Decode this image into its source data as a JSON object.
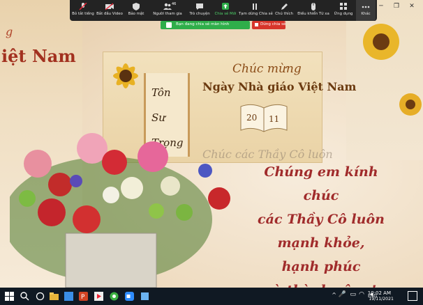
{
  "toolbar": {
    "items": [
      {
        "label": "Bỏ tắt tiếng",
        "icon": "microphone-muted-icon"
      },
      {
        "label": "Bắt đầu Video",
        "icon": "video-off-icon"
      },
      {
        "label": "Bảo mật",
        "icon": "shield-icon"
      },
      {
        "label": "Người tham gia",
        "icon": "participants-icon",
        "count": "46"
      },
      {
        "label": "Trò chuyện",
        "icon": "chat-icon"
      },
      {
        "label": "Chia sẻ Mới",
        "icon": "share-screen-icon"
      },
      {
        "label": "Tạm dừng Chia sẻ",
        "icon": "pause-icon"
      },
      {
        "label": "Chú thích",
        "icon": "pencil-icon"
      },
      {
        "label": "Điều khiển Từ xa",
        "icon": "mouse-icon"
      },
      {
        "label": "Ứng dụng",
        "icon": "apps-icon"
      },
      {
        "label": "Khác",
        "icon": "more-icon"
      }
    ],
    "share_status": "Bạn đang chia sẻ màn hình",
    "stop_share": "Dừng chia sẻ"
  },
  "slide": {
    "left_title_small": "g",
    "left_title": "iệt Nam",
    "greeting": "Chúc mừng",
    "title": "Ngày Nhà giáo Việt Nam",
    "date_day": "20",
    "date_month": "11",
    "scroll_lines": [
      "Tôn",
      "Sư",
      "Trọng"
    ],
    "faint_text": "Chúc các Thầy Cô luôn",
    "message_lines": [
      "Chúng em kính chúc",
      "các Thầy Cô luôn",
      "mạnh khỏe,",
      "hạnh phúc",
      "và thành công!"
    ]
  },
  "taskbar": {
    "language": "ENG",
    "time": "10:02 AM",
    "date": "19/11/2021"
  },
  "colors": {
    "toolbar_bg": "#232323",
    "share_green": "#2fae4a",
    "stop_red": "#d7352b",
    "message_red": "#a02b2b",
    "taskbar_bg": "#101923"
  }
}
